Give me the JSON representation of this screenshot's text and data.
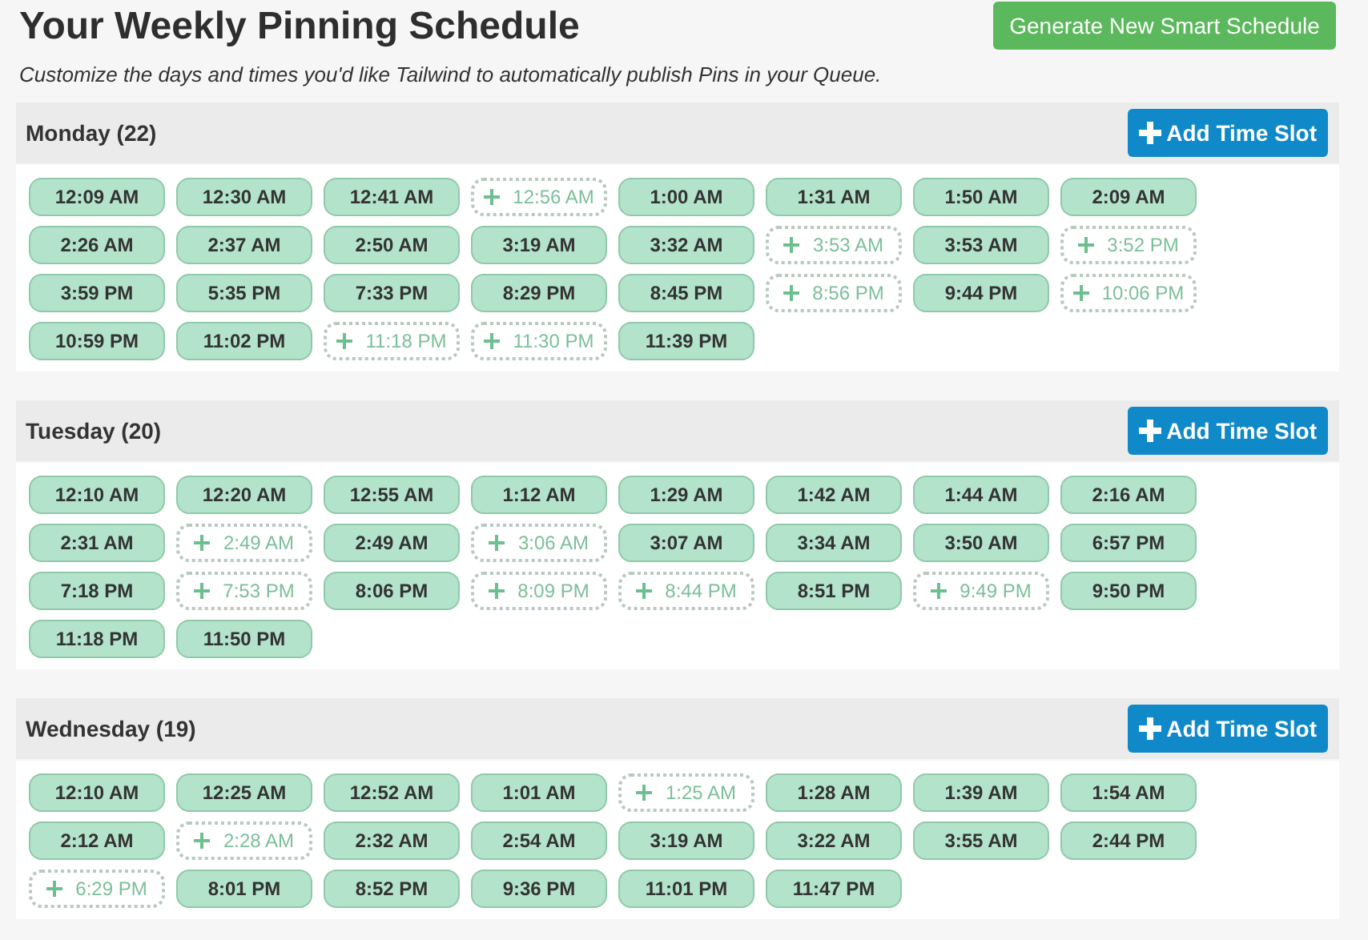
{
  "title": "Your Weekly Pinning Schedule",
  "generate_button": "Generate New Smart Schedule",
  "subtitle": "Customize the days and times you'd like Tailwind to automatically publish Pins in your Queue.",
  "days": [
    {
      "label": "Monday (22)",
      "add_button": "Add Time Slot",
      "slots": [
        {
          "time": "12:09 AM",
          "kind": "scheduled"
        },
        {
          "time": "12:30 AM",
          "kind": "scheduled"
        },
        {
          "time": "12:41 AM",
          "kind": "scheduled"
        },
        {
          "time": "12:56 AM",
          "kind": "suggested"
        },
        {
          "time": "1:00 AM",
          "kind": "scheduled"
        },
        {
          "time": "1:31 AM",
          "kind": "scheduled"
        },
        {
          "time": "1:50 AM",
          "kind": "scheduled"
        },
        {
          "time": "2:09 AM",
          "kind": "scheduled"
        },
        {
          "time": "2:26 AM",
          "kind": "scheduled"
        },
        {
          "time": "2:37 AM",
          "kind": "scheduled"
        },
        {
          "time": "2:50 AM",
          "kind": "scheduled"
        },
        {
          "time": "3:19 AM",
          "kind": "scheduled"
        },
        {
          "time": "3:32 AM",
          "kind": "scheduled"
        },
        {
          "time": "3:53 AM",
          "kind": "suggested"
        },
        {
          "time": "3:53 AM",
          "kind": "scheduled"
        },
        {
          "time": "3:52 PM",
          "kind": "suggested"
        },
        {
          "time": "3:59 PM",
          "kind": "scheduled"
        },
        {
          "time": "5:35 PM",
          "kind": "scheduled"
        },
        {
          "time": "7:33 PM",
          "kind": "scheduled"
        },
        {
          "time": "8:29 PM",
          "kind": "scheduled"
        },
        {
          "time": "8:45 PM",
          "kind": "scheduled"
        },
        {
          "time": "8:56 PM",
          "kind": "suggested"
        },
        {
          "time": "9:44 PM",
          "kind": "scheduled"
        },
        {
          "time": "10:06 PM",
          "kind": "suggested"
        },
        {
          "time": "10:59 PM",
          "kind": "scheduled"
        },
        {
          "time": "11:02 PM",
          "kind": "scheduled"
        },
        {
          "time": "11:18 PM",
          "kind": "suggested"
        },
        {
          "time": "11:30 PM",
          "kind": "suggested"
        },
        {
          "time": "11:39 PM",
          "kind": "scheduled"
        }
      ]
    },
    {
      "label": "Tuesday (20)",
      "add_button": "Add Time Slot",
      "slots": [
        {
          "time": "12:10 AM",
          "kind": "scheduled"
        },
        {
          "time": "12:20 AM",
          "kind": "scheduled"
        },
        {
          "time": "12:55 AM",
          "kind": "scheduled"
        },
        {
          "time": "1:12 AM",
          "kind": "scheduled"
        },
        {
          "time": "1:29 AM",
          "kind": "scheduled"
        },
        {
          "time": "1:42 AM",
          "kind": "scheduled"
        },
        {
          "time": "1:44 AM",
          "kind": "scheduled"
        },
        {
          "time": "2:16 AM",
          "kind": "scheduled"
        },
        {
          "time": "2:31 AM",
          "kind": "scheduled"
        },
        {
          "time": "2:49 AM",
          "kind": "suggested"
        },
        {
          "time": "2:49 AM",
          "kind": "scheduled"
        },
        {
          "time": "3:06 AM",
          "kind": "suggested"
        },
        {
          "time": "3:07 AM",
          "kind": "scheduled"
        },
        {
          "time": "3:34 AM",
          "kind": "scheduled"
        },
        {
          "time": "3:50 AM",
          "kind": "scheduled"
        },
        {
          "time": "6:57 PM",
          "kind": "scheduled"
        },
        {
          "time": "7:18 PM",
          "kind": "scheduled"
        },
        {
          "time": "7:53 PM",
          "kind": "suggested"
        },
        {
          "time": "8:06 PM",
          "kind": "scheduled"
        },
        {
          "time": "8:09 PM",
          "kind": "suggested"
        },
        {
          "time": "8:44 PM",
          "kind": "suggested"
        },
        {
          "time": "8:51 PM",
          "kind": "scheduled"
        },
        {
          "time": "9:49 PM",
          "kind": "suggested"
        },
        {
          "time": "9:50 PM",
          "kind": "scheduled"
        },
        {
          "time": "11:18 PM",
          "kind": "scheduled"
        },
        {
          "time": "11:50 PM",
          "kind": "scheduled"
        }
      ]
    },
    {
      "label": "Wednesday (19)",
      "add_button": "Add Time Slot",
      "slots": [
        {
          "time": "12:10 AM",
          "kind": "scheduled"
        },
        {
          "time": "12:25 AM",
          "kind": "scheduled"
        },
        {
          "time": "12:52 AM",
          "kind": "scheduled"
        },
        {
          "time": "1:01 AM",
          "kind": "scheduled"
        },
        {
          "time": "1:25 AM",
          "kind": "suggested"
        },
        {
          "time": "1:28 AM",
          "kind": "scheduled"
        },
        {
          "time": "1:39 AM",
          "kind": "scheduled"
        },
        {
          "time": "1:54 AM",
          "kind": "scheduled"
        },
        {
          "time": "2:12 AM",
          "kind": "scheduled"
        },
        {
          "time": "2:28 AM",
          "kind": "suggested"
        },
        {
          "time": "2:32 AM",
          "kind": "scheduled"
        },
        {
          "time": "2:54 AM",
          "kind": "scheduled"
        },
        {
          "time": "3:19 AM",
          "kind": "scheduled"
        },
        {
          "time": "3:22 AM",
          "kind": "scheduled"
        },
        {
          "time": "3:55 AM",
          "kind": "scheduled"
        },
        {
          "time": "2:44 PM",
          "kind": "scheduled"
        },
        {
          "time": "6:29 PM",
          "kind": "suggested"
        },
        {
          "time": "8:01 PM",
          "kind": "scheduled"
        },
        {
          "time": "8:52 PM",
          "kind": "scheduled"
        },
        {
          "time": "9:36 PM",
          "kind": "scheduled"
        },
        {
          "time": "11:01 PM",
          "kind": "scheduled"
        },
        {
          "time": "11:47 PM",
          "kind": "scheduled"
        }
      ]
    }
  ]
}
